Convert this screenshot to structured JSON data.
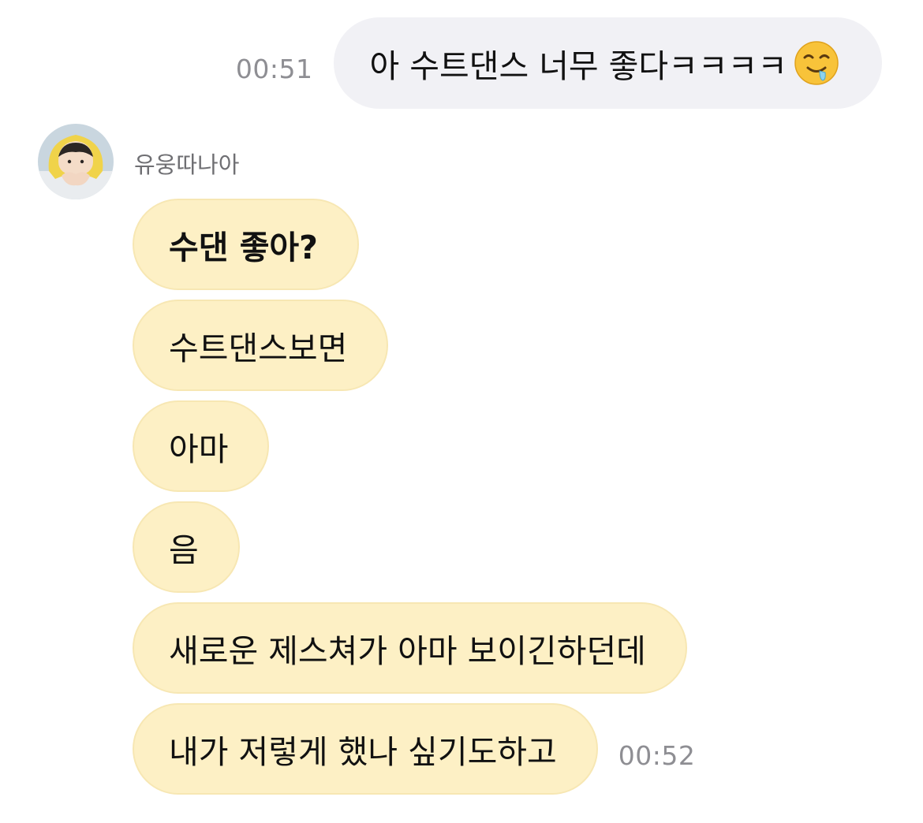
{
  "sent": {
    "time": "00:51",
    "text": "아 수트댄스 너무 좋다ㅋㅋㅋㅋ",
    "emoji": "drooling-face-icon"
  },
  "sender": {
    "name": "유웅따나아",
    "avatar": "profile-photo"
  },
  "received": [
    {
      "text": "수댄 좋아?"
    },
    {
      "text": "수트댄스보면"
    },
    {
      "text": "아마"
    },
    {
      "text": "음"
    },
    {
      "text": "새로운 제스쳐가 아마 보이긴하던데"
    },
    {
      "text": "내가 저렇게 했나 싶기도하고",
      "time": "00:52"
    }
  ],
  "colors": {
    "sent_bubble": "#f1f1f5",
    "received_bubble": "#fdf0c5",
    "timestamp": "#8e8e93"
  }
}
